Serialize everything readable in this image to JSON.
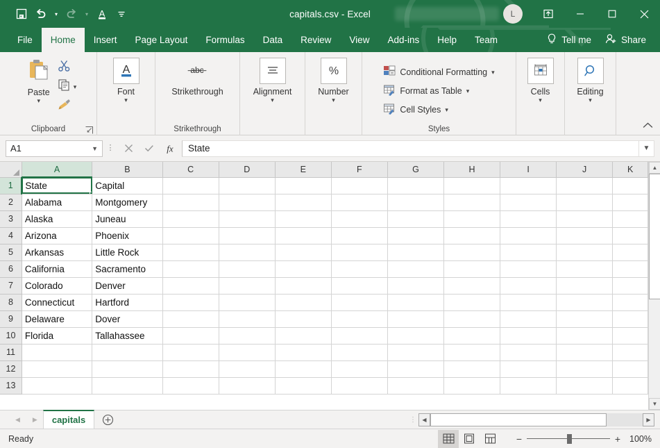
{
  "titlebar": {
    "document_title": "capitals.csv  -  Excel",
    "avatar_initial": "L",
    "qat": [
      {
        "name": "save-button",
        "icon": "save-icon"
      },
      {
        "name": "undo-button",
        "icon": "undo-icon"
      },
      {
        "name": "redo-button",
        "icon": "redo-icon"
      },
      {
        "name": "font-color-button",
        "icon": "font-color-icon"
      },
      {
        "name": "customize-qat-button",
        "icon": "customize-icon"
      }
    ],
    "window_controls": {
      "restore_label": "❐",
      "minimize_label": "─",
      "maximize_label": "☐",
      "close_label": "✕"
    }
  },
  "ribbon_tabs": [
    {
      "label": "File",
      "active": false
    },
    {
      "label": "Home",
      "active": true
    },
    {
      "label": "Insert",
      "active": false
    },
    {
      "label": "Page Layout",
      "active": false
    },
    {
      "label": "Formulas",
      "active": false
    },
    {
      "label": "Data",
      "active": false
    },
    {
      "label": "Review",
      "active": false
    },
    {
      "label": "View",
      "active": false
    },
    {
      "label": "Add-ins",
      "active": false
    },
    {
      "label": "Help",
      "active": false
    },
    {
      "label": "Team",
      "active": false
    }
  ],
  "ribbon_right": {
    "tell_me": "Tell me",
    "share": "Share"
  },
  "ribbon": {
    "groups": [
      {
        "label": "Clipboard",
        "paste_label": "Paste"
      },
      {
        "label": "Strikethrough",
        "buttons": [
          {
            "label": "Font",
            "glyph": "A"
          },
          {
            "label": "Strikethrough",
            "glyph": "abc"
          },
          {
            "label": "Alignment",
            "glyph": "≡"
          },
          {
            "label": "Number",
            "glyph": "%"
          }
        ]
      },
      {
        "label": "Styles",
        "items": [
          {
            "label": "Conditional Formatting"
          },
          {
            "label": "Format as Table"
          },
          {
            "label": "Cell Styles"
          }
        ]
      },
      {
        "label": "",
        "buttons": [
          {
            "label": "Cells"
          },
          {
            "label": "Editing"
          }
        ]
      }
    ]
  },
  "formula_bar": {
    "name_box_value": "A1",
    "cancel_label": "✕",
    "enter_label": "✓",
    "fx_label": "fx",
    "formula_value": "State"
  },
  "grid": {
    "columns": [
      "A",
      "B",
      "C",
      "D",
      "E",
      "F",
      "G",
      "H",
      "I",
      "J",
      "K"
    ],
    "rows": [
      "1",
      "2",
      "3",
      "4",
      "5",
      "6",
      "7",
      "8",
      "9",
      "10",
      "11",
      "12",
      "13"
    ],
    "selected_cell": "A1",
    "data": [
      [
        "State",
        "Capital"
      ],
      [
        "Alabama",
        "Montgomery"
      ],
      [
        "Alaska",
        "Juneau"
      ],
      [
        "Arizona",
        "Phoenix"
      ],
      [
        "Arkansas",
        "Little Rock"
      ],
      [
        "California",
        "Sacramento"
      ],
      [
        "Colorado",
        "Denver"
      ],
      [
        "Connecticut",
        "Hartford"
      ],
      [
        "Delaware",
        "Dover"
      ],
      [
        "Florida",
        "Tallahassee"
      ],
      [
        "",
        ""
      ],
      [
        "",
        ""
      ],
      [
        "",
        ""
      ]
    ]
  },
  "sheet_tabs": {
    "tabs": [
      {
        "label": "capitals",
        "active": true
      }
    ],
    "add_sheet_label": "+"
  },
  "status_bar": {
    "status_text": "Ready",
    "zoom_level": "100%",
    "zoom_out_label": "−",
    "zoom_in_label": "+",
    "views": [
      "normal-view",
      "page-layout-view",
      "page-break-view"
    ]
  },
  "colors": {
    "brand_green": "#217346",
    "ribbon_bg": "#f3f2f1",
    "header_bg": "#e8e8e8",
    "selection_green": "#217346"
  }
}
